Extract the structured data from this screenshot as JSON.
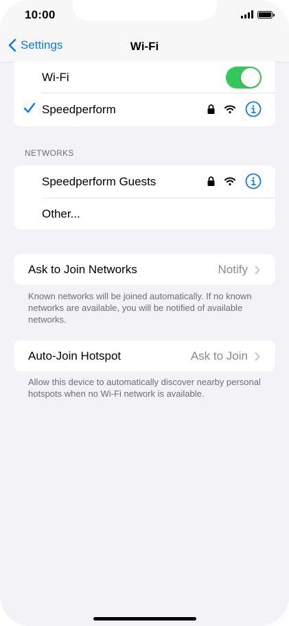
{
  "status_bar": {
    "time": "10:00"
  },
  "nav": {
    "back_label": "Settings",
    "title": "Wi-Fi"
  },
  "wifi_group": {
    "toggle_label": "Wi-Fi",
    "toggle_on": true,
    "connected_network": "Speedperform"
  },
  "networks": {
    "header": "NETWORKS",
    "items": [
      {
        "label": "Speedperform Guests",
        "secured": true
      },
      {
        "label": "Other..."
      }
    ]
  },
  "ask_to_join": {
    "label": "Ask to Join Networks",
    "value": "Notify",
    "footnote": "Known networks will be joined automatically. If no known networks are available, you will be notified of available networks."
  },
  "auto_join": {
    "label": "Auto-Join Hotspot",
    "value": "Ask to Join",
    "footnote": "Allow this device to automatically discover nearby personal hotspots when no Wi-Fi network is available."
  },
  "colors": {
    "accent": "#0a7aff",
    "toggle_on": "#34c759",
    "background": "#f2f2f7",
    "secondary_text": "#8a8a8e"
  },
  "icons": [
    "back-chevron-icon",
    "checkmark-icon",
    "lock-icon",
    "wifi-icon",
    "info-icon",
    "chevron-right-icon",
    "signal-icon",
    "battery-icon"
  ]
}
